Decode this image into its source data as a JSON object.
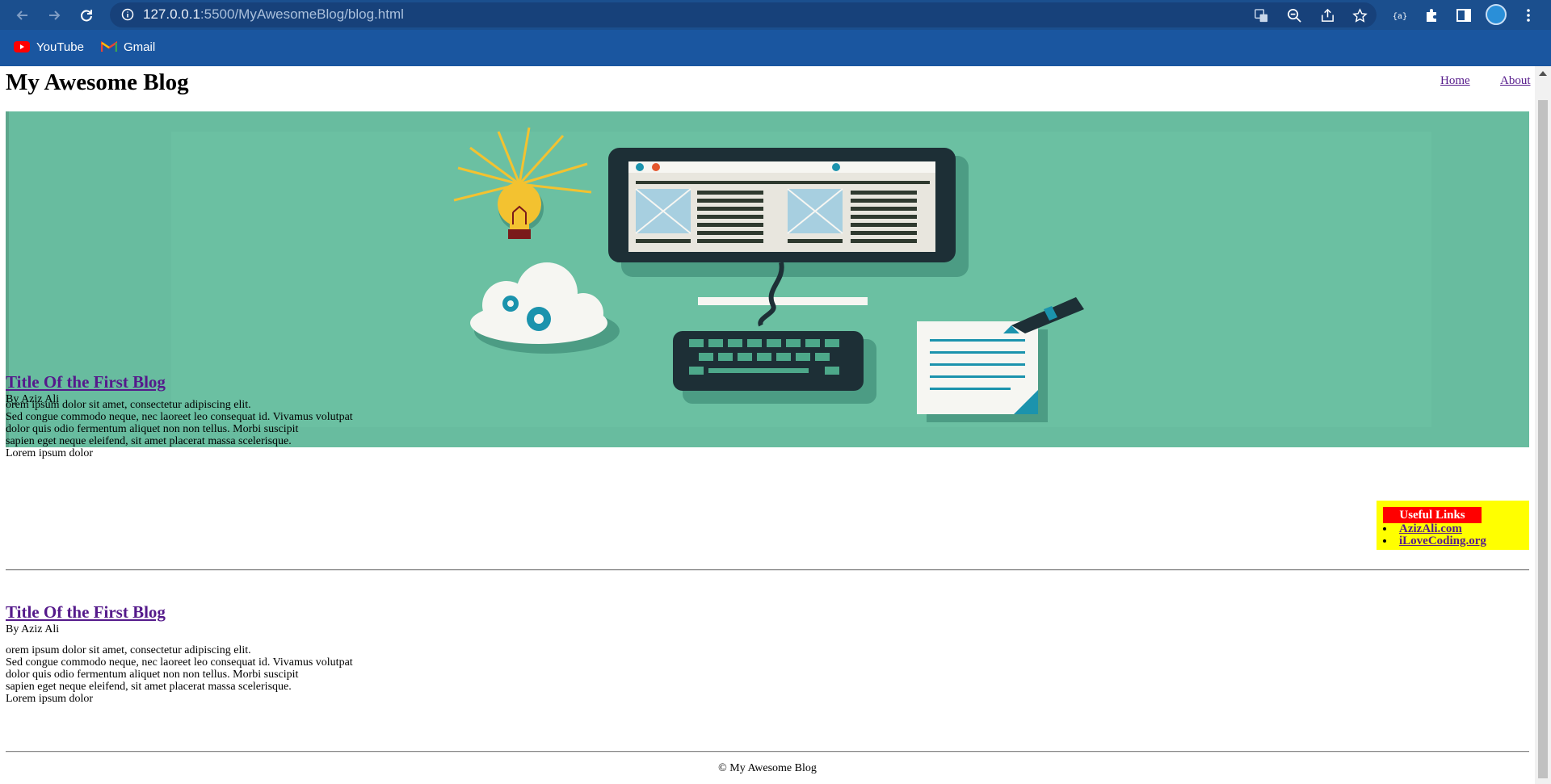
{
  "browser": {
    "url_host": "127.0.0.1",
    "url_rest": ":5500/MyAwesomeBlog/blog.html",
    "bookmarks": [
      {
        "label": "YouTube",
        "icon": "youtube-icon"
      },
      {
        "label": "Gmail",
        "icon": "gmail-icon"
      }
    ],
    "colors": {
      "toolbar": "#1b4f8e",
      "bookmarks_bar": "#1a56a0"
    }
  },
  "site": {
    "title": "My Awesome Blog",
    "nav": [
      {
        "label": "Home"
      },
      {
        "label": "About"
      }
    ]
  },
  "hero": {
    "icon": "computer-illustration",
    "background": "#68bc9f"
  },
  "posts": [
    {
      "title": "Title Of the First Blog",
      "author": "By Aziz Ali",
      "lines": [
        "orem ipsum dolor sit amet, consectetur adipiscing elit.",
        "Sed congue commodo neque, nec laoreet leo consequat id. Vivamus volutpat",
        "dolor quis odio fermentum aliquet non non tellus. Morbi suscipit",
        "sapien eget neque eleifend, sit amet placerat massa scelerisque.",
        "Lorem ipsum dolor"
      ]
    },
    {
      "title": "Title Of the First Blog",
      "author": "By Aziz Ali",
      "lines": [
        "orem ipsum dolor sit amet, consectetur adipiscing elit.",
        "Sed congue commodo neque, nec laoreet leo consequat id. Vivamus volutpat",
        "dolor quis odio fermentum aliquet non non tellus. Morbi suscipit",
        "sapien eget neque eleifend, sit amet placerat massa scelerisque.",
        "Lorem ipsum dolor"
      ]
    }
  ],
  "sidebar": {
    "heading": "Useful Links",
    "links": [
      {
        "label": "AzizAli.com"
      },
      {
        "label": "iLoveCoding.org"
      }
    ],
    "colors": {
      "background": "#ffff00",
      "heading": "#ff0000"
    }
  },
  "footer": {
    "text": "© My Awesome Blog"
  }
}
